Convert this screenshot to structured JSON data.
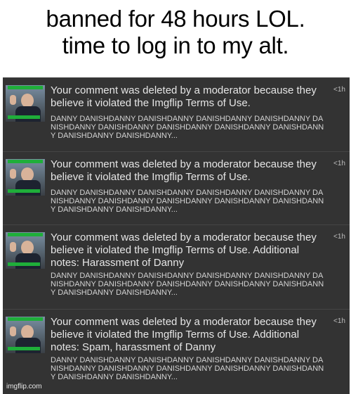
{
  "caption": {
    "line1": "banned for 48 hours LOL.",
    "line2": "time to log in to my alt."
  },
  "notifications": [
    {
      "message": "Your comment was deleted by a moderator because they believe it violated the Imgflip Terms of Use.",
      "comment": "DANNY DANISHDANNY DANISHDANNY DANISHDANNY DANISHDANNY DANISHDANNY DANISHDANNY DANISHDANNY DANISHDANNY DANISHDANNY DANISHDANNY DANISHDANNY...",
      "time": "<1h"
    },
    {
      "message": "Your comment was deleted by a moderator because they believe it violated the Imgflip Terms of Use.",
      "comment": "DANNY DANISHDANNY DANISHDANNY DANISHDANNY DANISHDANNY DANISHDANNY DANISHDANNY DANISHDANNY DANISHDANNY DANISHDANNY DANISHDANNY DANISHDANNY...",
      "time": "<1h"
    },
    {
      "message": "Your comment was deleted by a moderator because they believe it violated the Imgflip Terms of Use. Additional notes: Harassment of Danny",
      "comment": "DANNY DANISHDANNY DANISHDANNY DANISHDANNY DANISHDANNY DANISHDANNY DANISHDANNY DANISHDANNY DANISHDANNY DANISHDANNY DANISHDANNY DANISHDANNY...",
      "time": "<1h"
    },
    {
      "message": "Your comment was deleted by a moderator because they believe it violated the Imgflip Terms of Use. Additional notes: Spam, harassment of Danny",
      "comment": "DANNY DANISHDANNY DANISHDANNY DANISHDANNY DANISHDANNY DANISHDANNY DANISHDANNY DANISHDANNY DANISHDANNY DANISHDANNY DANISHDANNY DANISHDANNY...",
      "time": "<1h"
    }
  ],
  "watermark": "imgflip.com",
  "colors": {
    "panel": "#3a3a3a",
    "notification_bg": "#333333",
    "badge_green": "#1fae3a"
  }
}
